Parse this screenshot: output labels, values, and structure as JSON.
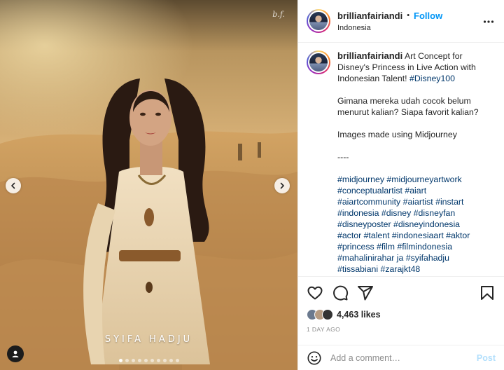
{
  "post": {
    "image_caption": "SYIFA HADJU",
    "watermark": "b.f.",
    "slide_count": 10,
    "active_slide": 1
  },
  "header": {
    "username": "brillianfairiandi",
    "separator": "•",
    "follow_label": "Follow",
    "location": "Indonesia"
  },
  "caption": {
    "username": "brillianfairiandi",
    "text": "Art Concept for Disney's Princess in Live Action with Indonesian Talent!",
    "highlight": "#Disney100",
    "para2": "Gimana mereka udah cocok belum menurut kalian? Siapa favorit kalian?",
    "para3": "Images made using Midjourney",
    "para4": "----",
    "hashtags": [
      "#midjourney #midjourneyartwork",
      "#conceptualartist #aiart",
      "#aiartcommunity #aiartist #instart",
      "#indonesia #disney #disneyfan",
      "#disneyposter #disneyindonesia",
      "#actor #talent #indonesiaart #aktor",
      "#princess #film #filmindonesia",
      "#mahalinirahar ja #syifahadju",
      "#tissabiani #zarajkt48"
    ]
  },
  "actions": {
    "likes": "4,463 likes",
    "time": "1 DAY AGO"
  },
  "comment_bar": {
    "placeholder": "Add a comment…",
    "post_label": "Post"
  },
  "icons": [
    "chevron-left-icon",
    "chevron-right-icon",
    "user-tag-icon",
    "more-icon",
    "heart-icon",
    "comment-icon",
    "share-icon",
    "bookmark-icon",
    "emoji-icon"
  ],
  "colors": {
    "link_blue": "#0095f6",
    "hashtag_blue": "#00376b",
    "post_disabled": "#b2dffc",
    "muted": "#8e8e8e"
  }
}
